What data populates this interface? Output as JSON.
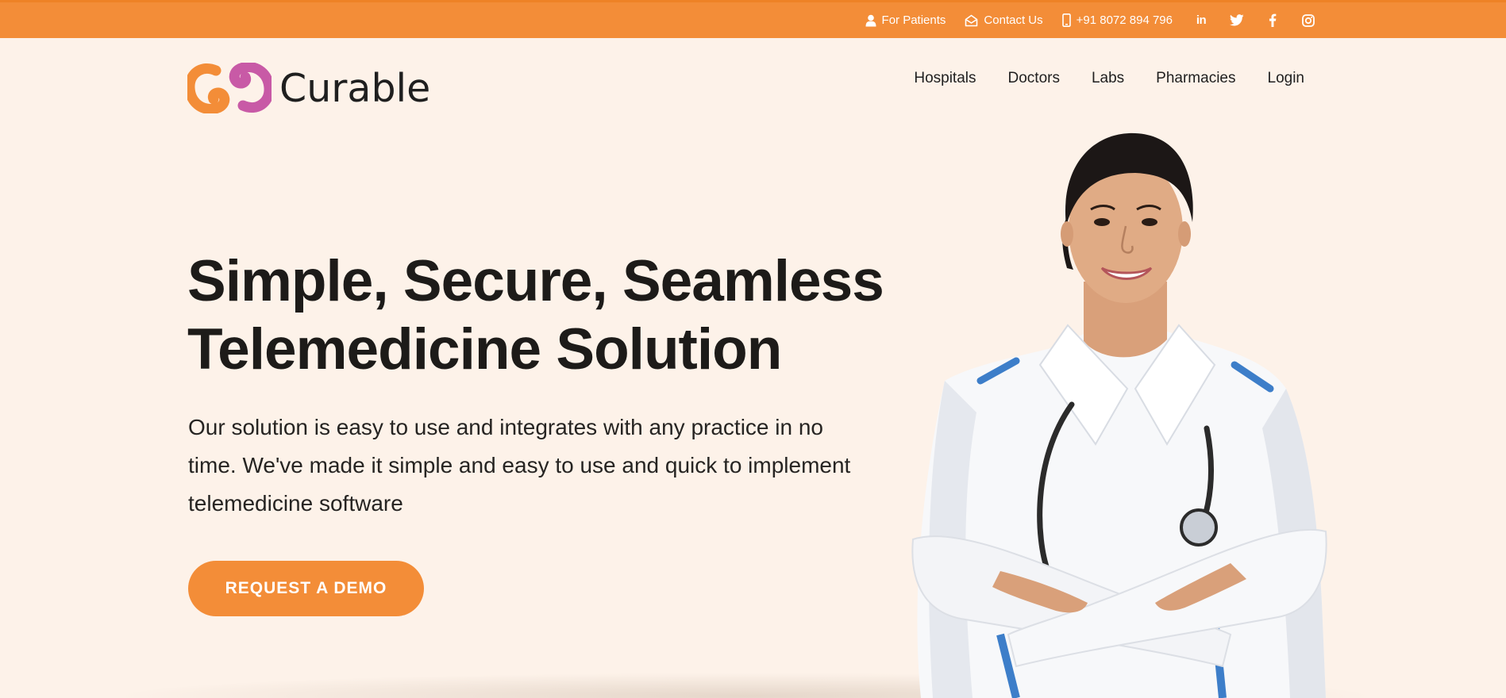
{
  "topbar": {
    "for_patients": "For Patients",
    "contact_us": "Contact Us",
    "phone": "+91 8072 894 796",
    "social": [
      "linkedin",
      "twitter",
      "facebook",
      "instagram"
    ]
  },
  "brand": {
    "name": "Curable",
    "colors": {
      "orange": "#f38d38",
      "pink": "#c85aa6",
      "background": "#fdf2e9"
    }
  },
  "nav": {
    "items": [
      "Hospitals",
      "Doctors",
      "Labs",
      "Pharmacies",
      "Login"
    ]
  },
  "hero": {
    "title_line1": "Simple, Secure, Seamless",
    "title_line2": "Telemedicine Solution",
    "description": "Our solution is easy to use and integrates with any practice in no time. We've made it simple and easy to use and quick to implement telemedicine software",
    "cta_label": "REQUEST A DEMO"
  },
  "icons": {
    "user": "user-icon",
    "mail": "envelope-open-icon",
    "phone": "mobile-phone-icon",
    "linkedin": "linkedin-icon",
    "twitter": "twitter-icon",
    "facebook": "facebook-icon",
    "instagram": "instagram-icon"
  }
}
